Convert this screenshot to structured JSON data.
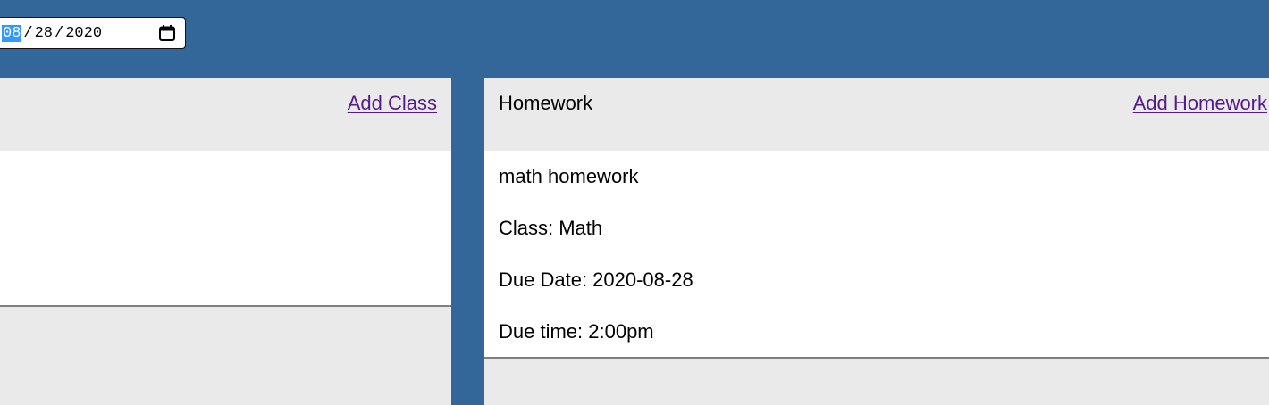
{
  "date_picker": {
    "month": "08",
    "day": "28",
    "year": "2020",
    "icon": "calendar-icon"
  },
  "classes_panel": {
    "add_label": "Add Class"
  },
  "homework_panel": {
    "title": "Homework",
    "add_label": "Add Homework",
    "items": [
      {
        "name": "math homework",
        "class_line": "Class: Math",
        "due_date_line": "Due Date: 2020-08-28",
        "due_time_line": "Due time: 2:00pm"
      }
    ]
  },
  "colors": {
    "background": "#336699",
    "panel": "#eaeaea",
    "link": "#551a8b",
    "selection": "#3399ff"
  }
}
